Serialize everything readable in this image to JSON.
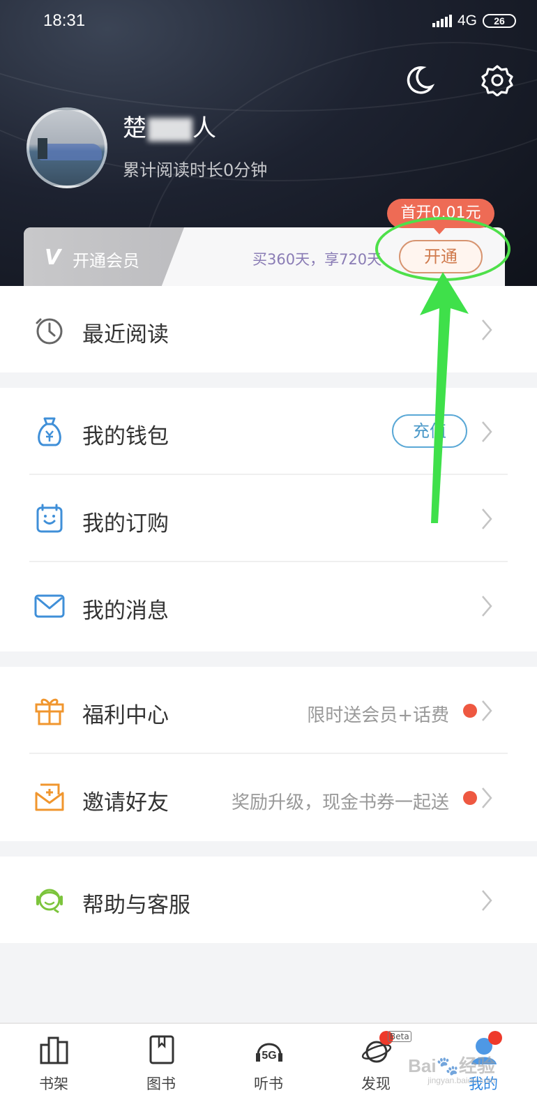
{
  "status_bar": {
    "time": "18:31",
    "network": "4G",
    "battery": "26"
  },
  "profile": {
    "name_prefix": "楚",
    "name_suffix": "人",
    "read_time": "累计阅读时长0分钟"
  },
  "vip": {
    "label": "开通会员",
    "logo": "V",
    "promo": "买360天，享720天",
    "button": "开通",
    "badge": "首开0.01元"
  },
  "menu": {
    "recent": "最近阅读",
    "wallet": "我的钱包",
    "wallet_button": "充值",
    "subscriptions": "我的订购",
    "messages": "我的消息",
    "welfare": "福利中心",
    "welfare_hint": "限时送会员+话费",
    "invite": "邀请好友",
    "invite_hint": "奖励升级，现金书券一起送",
    "help": "帮助与客服"
  },
  "nav": {
    "bookshelf": "书架",
    "books": "图书",
    "audio": "听书",
    "discover": "发现",
    "discover_badge": "Beta",
    "mine": "我的",
    "audio_icon_text": "5G"
  },
  "watermark": {
    "main": "Bai🐾经验",
    "sub": "jingyan.baidu.com"
  },
  "colors": {
    "accent": "#2f86e0",
    "badge_red": "#ee6b55",
    "annotation_green": "#4ee04a"
  }
}
